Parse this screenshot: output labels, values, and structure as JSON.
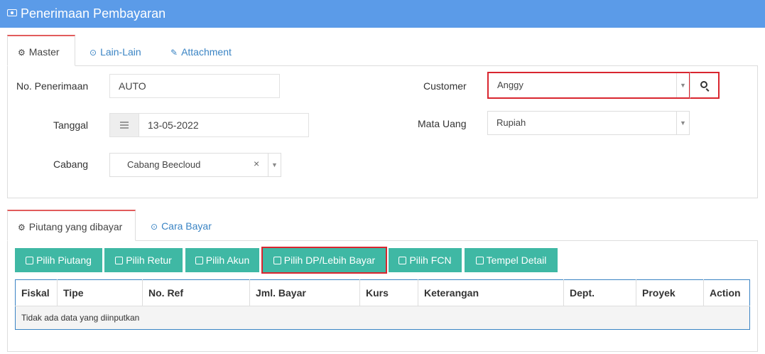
{
  "header": {
    "title": "Penerimaan Pembayaran",
    "icon": "money-icon"
  },
  "top_tabs": [
    {
      "label": "Master",
      "icon": "gears-icon",
      "active": true
    },
    {
      "label": "Lain-Lain",
      "icon": "check-circle-icon",
      "active": false
    },
    {
      "label": "Attachment",
      "icon": "paperclip-icon",
      "active": false
    }
  ],
  "form": {
    "no_penerimaan": {
      "label": "No. Penerimaan",
      "value": "AUTO"
    },
    "tanggal": {
      "label": "Tanggal",
      "value": "13-05-2022"
    },
    "cabang": {
      "label": "Cabang",
      "value": "Cabang Beecloud",
      "clear": "×"
    },
    "customer": {
      "label": "Customer",
      "value": "Anggy"
    },
    "mata_uang": {
      "label": "Mata Uang",
      "value": "Rupiah"
    }
  },
  "detail_tabs": [
    {
      "label": "Piutang yang dibayar",
      "icon": "gears-icon",
      "active": true
    },
    {
      "label": "Cara Bayar",
      "icon": "check-circle-icon",
      "active": false
    }
  ],
  "buttons": [
    {
      "label": "Pilih Piutang"
    },
    {
      "label": "Pilih Retur"
    },
    {
      "label": "Pilih Akun"
    },
    {
      "label": "Pilih DP/Lebih Bayar",
      "highlight": "#d9262f"
    },
    {
      "label": "Pilih FCN"
    },
    {
      "label": "Tempel Detail"
    }
  ],
  "table": {
    "columns": [
      "Fiskal",
      "Tipe",
      "No. Ref",
      "Jml. Bayar",
      "Kurs",
      "Keterangan",
      "Dept.",
      "Proyek",
      "Action"
    ],
    "empty_text": "Tidak ada data yang diinputkan"
  },
  "colors": {
    "header": "#5b9be8",
    "button": "#3fb8a4",
    "highlight": "#d9262f",
    "link": "#3a84c4",
    "active_tab": "#e25c5c"
  }
}
